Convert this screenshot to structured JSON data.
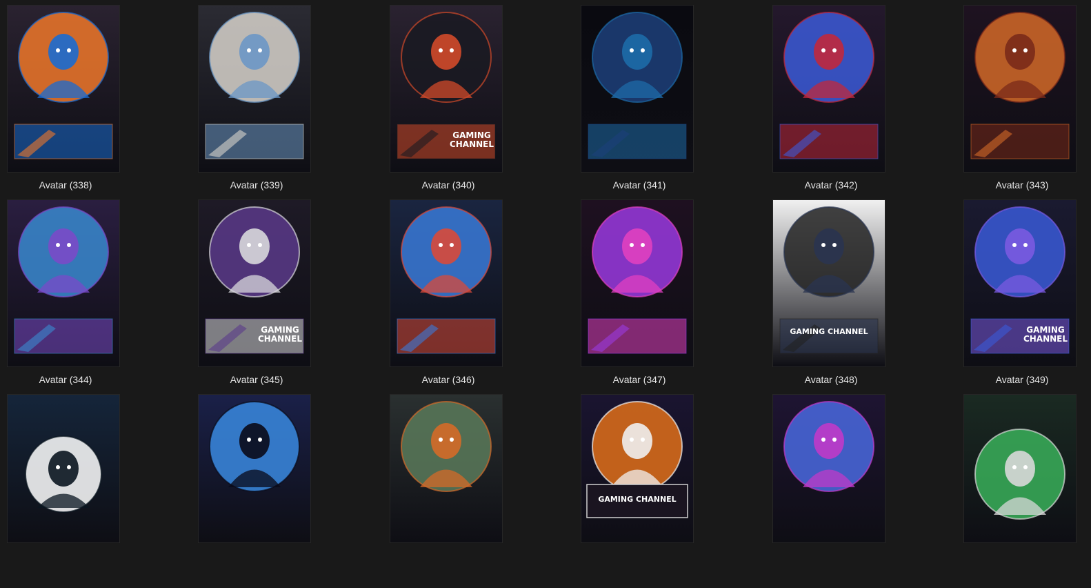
{
  "explorer": {
    "items": [
      {
        "label": "Avatar  (338)",
        "icon": "gamer-headset-avatar-icon",
        "colors": [
          "#2a2230",
          "#f0782a",
          "#1a6bd0"
        ],
        "banner": ""
      },
      {
        "label": "Avatar  (339)",
        "icon": "helmet-ninja-avatar-icon",
        "colors": [
          "#2b2b33",
          "#d8d4cc",
          "#6b97c5"
        ],
        "banner": ""
      },
      {
        "label": "Avatar  (340)",
        "icon": "hooded-assassin-avatar-icon",
        "colors": [
          "#2a2230",
          "#1a1a22",
          "#d24a2a"
        ],
        "banner": "GAMING\nCHANNEL"
      },
      {
        "label": "Avatar  (341)",
        "icon": "hooded-cyber-avatar-icon",
        "colors": [
          "#0a0a10",
          "#1d3f7a",
          "#1d6ba8"
        ],
        "banner": ""
      },
      {
        "label": "Avatar  (342)",
        "icon": "speed-runner-avatar-icon",
        "colors": [
          "#24182c",
          "#3c5ad8",
          "#c0283c"
        ],
        "banner": ""
      },
      {
        "label": "Avatar  (343)",
        "icon": "hooded-warrior-avatar-icon",
        "colors": [
          "#1e1220",
          "#d46a28",
          "#7a2a1a"
        ],
        "banner": ""
      },
      {
        "label": "Avatar  (344)",
        "icon": "skull-cap-kid-avatar-icon",
        "colors": [
          "#2a1e40",
          "#3a8ad0",
          "#7a4ac8"
        ],
        "banner": ""
      },
      {
        "label": "Avatar  (345)",
        "icon": "masked-reaper-avatar-icon",
        "colors": [
          "#1e1a26",
          "#5a3a8a",
          "#d8d8dc"
        ],
        "banner": "GAMING\nCHANNEL"
      },
      {
        "label": "Avatar  (346)",
        "icon": "space-trooper-avatar-icon",
        "colors": [
          "#1a2540",
          "#3a7ad8",
          "#d84a3a"
        ],
        "banner": ""
      },
      {
        "label": "Avatar  (347)",
        "icon": "anime-gamer-avatar-icon",
        "colors": [
          "#1e1020",
          "#9a3ae0",
          "#e040c0"
        ],
        "banner": ""
      },
      {
        "label": "Avatar  (348)",
        "icon": "hoodie-boy-avatar-icon",
        "colors": [
          "#f0f0f0",
          "#222222",
          "#2a3450"
        ],
        "banner": "GAMING CHANNEL"
      },
      {
        "label": "Avatar  (349)",
        "icon": "cyber-hood-avatar-icon",
        "colors": [
          "#1a1a30",
          "#3a5ad8",
          "#7a5ae0"
        ],
        "banner": "GAMING\nCHANNEL"
      },
      {
        "label": "",
        "icon": "white-silhouette-avatar-icon",
        "colors": [
          "#15253a",
          "#ffffff",
          "#0a1520"
        ],
        "banner": ""
      },
      {
        "label": "",
        "icon": "storm-knight-avatar-icon",
        "colors": [
          "#1a2048",
          "#3a8ae0",
          "#0a0a18"
        ],
        "banner": ""
      },
      {
        "label": "",
        "icon": "elf-warrior-avatar-icon",
        "colors": [
          "#2a3030",
          "#5a7a5a",
          "#d46a28"
        ],
        "banner": ""
      },
      {
        "label": "",
        "icon": "eyepatch-gamer-avatar-icon",
        "colors": [
          "#1a1430",
          "#e0701a",
          "#f0f0f0"
        ],
        "banner": "GAMING CHANNEL"
      },
      {
        "label": "",
        "icon": "grinning-monster-avatar-icon",
        "colors": [
          "#1e1432",
          "#4a6ae0",
          "#c03ac8"
        ],
        "banner": ""
      },
      {
        "label": "",
        "icon": "soldier-headset-avatar-icon",
        "colors": [
          "#1a2a22",
          "#3ab05a",
          "#d8d8d8"
        ],
        "banner": ""
      }
    ]
  }
}
